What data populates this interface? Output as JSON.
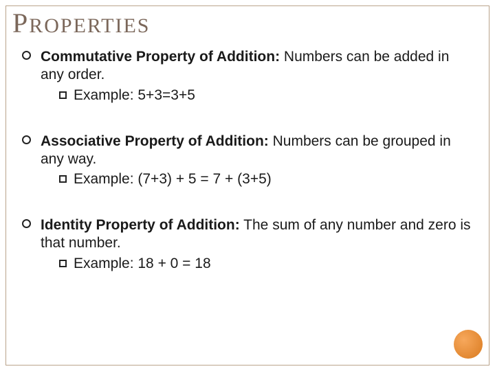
{
  "title": {
    "first_letter": "P",
    "rest": "ROPERTIES"
  },
  "properties": [
    {
      "name": "Commutative Property of Addition:",
      "description": " Numbers can be added in any order.",
      "example_label": "Example:",
      "example_value": " 5+3=3+5"
    },
    {
      "name": "Associative Property of Addition:",
      "description": " Numbers can be grouped in any way.",
      "example_label": "Example:",
      "example_value": " (7+3) + 5 = 7 + (3+5)"
    },
    {
      "name": "Identity Property of Addition:",
      "description": " The sum of any number and zero is that number.",
      "example_label": "Example:",
      "example_value": " 18 + 0 = 18"
    }
  ]
}
